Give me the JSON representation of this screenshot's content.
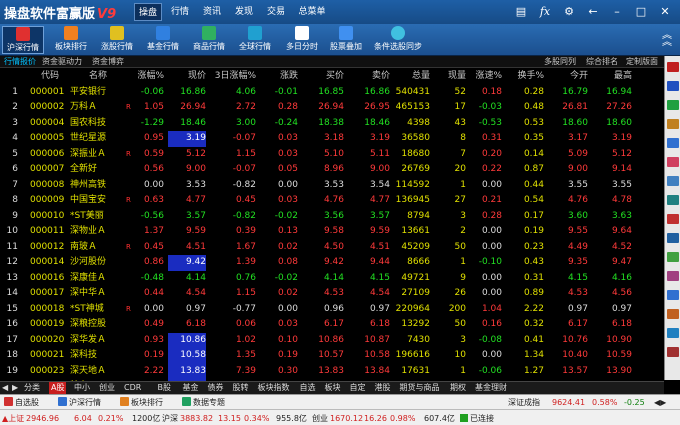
{
  "app": {
    "title": "操盘软件富赢版",
    "version": "V9"
  },
  "menu": [
    "操盘",
    "行情",
    "资讯",
    "发现",
    "交易",
    "总菜单"
  ],
  "toolbar": [
    {
      "label": "沪深行情",
      "color": "#e03030",
      "active": true
    },
    {
      "label": "板块排行",
      "color": "#f08020"
    },
    {
      "label": "涨股行情",
      "color": "#e0c020"
    },
    {
      "label": "基金行情",
      "color": "#3080e0"
    },
    {
      "label": "商品行情",
      "color": "#30b060"
    },
    {
      "label": "全球行情",
      "color": "#20a0d0"
    },
    {
      "label": "多日分时",
      "color": "#ffffff"
    },
    {
      "label": "股票叠加",
      "color": "#4090f0"
    },
    {
      "label": "条件选股同步",
      "color": "#40c0e0"
    }
  ],
  "subtabs": [
    "行情报价",
    "资金驱动力",
    "资金博弈"
  ],
  "subtabs_right": [
    "多股同列",
    "综合排名",
    "定制版面"
  ],
  "columns": [
    "代码",
    "名称",
    "涨幅%",
    "现价",
    "3日涨幅%",
    "涨跌",
    "买价",
    "卖价",
    "总量",
    "现量",
    "涨速%",
    "换手%",
    "今开",
    "最高"
  ],
  "rows": [
    {
      "i": "1",
      "code": "000001",
      "name": "平安银行",
      "flag": "",
      "pct": "-0.06",
      "price": "16.86",
      "d3": "4.06",
      "chg": "-0.01",
      "buy": "16.85",
      "sell": "16.86",
      "vol": "540431",
      "cur": "52",
      "spd": "0.18",
      "turn": "0.28",
      "open": "16.79",
      "high": "16.94",
      "dir": "dn"
    },
    {
      "i": "2",
      "code": "000002",
      "name": "万科Ａ",
      "flag": "R",
      "pct": "1.05",
      "price": "26.94",
      "d3": "2.72",
      "chg": "0.28",
      "buy": "26.94",
      "sell": "26.95",
      "vol": "465153",
      "cur": "17",
      "spd": "-0.03",
      "turn": "0.48",
      "open": "26.81",
      "high": "27.26",
      "dir": "up"
    },
    {
      "i": "3",
      "code": "000004",
      "name": "国农科技",
      "flag": "",
      "pct": "-1.29",
      "price": "18.46",
      "d3": "3.00",
      "chg": "-0.24",
      "buy": "18.38",
      "sell": "18.46",
      "vol": "4398",
      "cur": "43",
      "spd": "-0.53",
      "turn": "0.53",
      "open": "18.60",
      "high": "18.60",
      "dir": "dn"
    },
    {
      "i": "4",
      "code": "000005",
      "name": "世纪星源",
      "flag": "",
      "pct": "0.95",
      "price": "3.19",
      "d3": "-0.07",
      "chg": "0.03",
      "buy": "3.18",
      "sell": "3.19",
      "vol": "36580",
      "cur": "8",
      "spd": "0.31",
      "turn": "0.35",
      "open": "3.17",
      "high": "3.19",
      "dir": "up",
      "hl": true
    },
    {
      "i": "5",
      "code": "000006",
      "name": "深振业Ａ",
      "flag": "R",
      "pct": "0.59",
      "price": "5.12",
      "d3": "1.15",
      "chg": "0.03",
      "buy": "5.10",
      "sell": "5.11",
      "vol": "18680",
      "cur": "7",
      "spd": "0.20",
      "turn": "0.14",
      "open": "5.09",
      "high": "5.12",
      "dir": "up"
    },
    {
      "i": "6",
      "code": "000007",
      "name": "全新好",
      "flag": "",
      "pct": "0.56",
      "price": "9.00",
      "d3": "-0.07",
      "chg": "0.05",
      "buy": "8.96",
      "sell": "9.00",
      "vol": "26769",
      "cur": "20",
      "spd": "0.22",
      "turn": "0.87",
      "open": "9.00",
      "high": "9.14",
      "dir": "up"
    },
    {
      "i": "7",
      "code": "000008",
      "name": "神州高铁",
      "flag": "",
      "pct": "0.00",
      "price": "3.53",
      "d3": "-0.82",
      "chg": "0.00",
      "buy": "3.53",
      "sell": "3.54",
      "vol": "114592",
      "cur": "1",
      "spd": "0.00",
      "turn": "0.44",
      "open": "3.55",
      "high": "3.55",
      "dir": "eq"
    },
    {
      "i": "8",
      "code": "000009",
      "name": "中国宝安",
      "flag": "R",
      "pct": "0.63",
      "price": "4.77",
      "d3": "0.45",
      "chg": "0.03",
      "buy": "4.76",
      "sell": "4.77",
      "vol": "136945",
      "cur": "27",
      "spd": "0.21",
      "turn": "0.54",
      "open": "4.76",
      "high": "4.78",
      "dir": "up"
    },
    {
      "i": "9",
      "code": "000010",
      "name": "*ST美丽",
      "flag": "",
      "pct": "-0.56",
      "price": "3.57",
      "d3": "-0.82",
      "chg": "-0.02",
      "buy": "3.56",
      "sell": "3.57",
      "vol": "8794",
      "cur": "3",
      "spd": "0.28",
      "turn": "0.17",
      "open": "3.60",
      "high": "3.63",
      "dir": "dn"
    },
    {
      "i": "10",
      "code": "000011",
      "name": "深物业Ａ",
      "flag": "",
      "pct": "1.37",
      "price": "9.59",
      "d3": "0.39",
      "chg": "0.13",
      "buy": "9.58",
      "sell": "9.59",
      "vol": "13661",
      "cur": "2",
      "spd": "0.00",
      "turn": "0.19",
      "open": "9.55",
      "high": "9.64",
      "dir": "up"
    },
    {
      "i": "11",
      "code": "000012",
      "name": "南玻Ａ",
      "flag": "R",
      "pct": "0.45",
      "price": "4.51",
      "d3": "1.67",
      "chg": "0.02",
      "buy": "4.50",
      "sell": "4.51",
      "vol": "45209",
      "cur": "50",
      "spd": "0.00",
      "turn": "0.23",
      "open": "4.49",
      "high": "4.52",
      "dir": "up"
    },
    {
      "i": "12",
      "code": "000014",
      "name": "沙河股份",
      "flag": "",
      "pct": "0.86",
      "price": "9.42",
      "d3": "1.39",
      "chg": "0.08",
      "buy": "9.42",
      "sell": "9.44",
      "vol": "8666",
      "cur": "1",
      "spd": "-0.10",
      "turn": "0.43",
      "open": "9.35",
      "high": "9.47",
      "dir": "up",
      "hl": true
    },
    {
      "i": "13",
      "code": "000016",
      "name": "深康佳Ａ",
      "flag": "",
      "pct": "-0.48",
      "price": "4.14",
      "d3": "0.76",
      "chg": "-0.02",
      "buy": "4.14",
      "sell": "4.15",
      "vol": "49721",
      "cur": "9",
      "spd": "0.00",
      "turn": "0.31",
      "open": "4.15",
      "high": "4.16",
      "dir": "dn"
    },
    {
      "i": "14",
      "code": "000017",
      "name": "深中华Ａ",
      "flag": "",
      "pct": "0.44",
      "price": "4.54",
      "d3": "1.15",
      "chg": "0.02",
      "buy": "4.53",
      "sell": "4.54",
      "vol": "27109",
      "cur": "26",
      "spd": "0.00",
      "turn": "0.89",
      "open": "4.53",
      "high": "4.56",
      "dir": "up"
    },
    {
      "i": "15",
      "code": "000018",
      "name": "*ST神城",
      "flag": "R",
      "pct": "0.00",
      "price": "0.97",
      "d3": "-0.77",
      "chg": "0.00",
      "buy": "0.96",
      "sell": "0.97",
      "vol": "220964",
      "cur": "200",
      "spd": "1.04",
      "turn": "2.22",
      "open": "0.97",
      "high": "0.97",
      "dir": "eq"
    },
    {
      "i": "16",
      "code": "000019",
      "name": "深粮控股",
      "flag": "",
      "pct": "0.49",
      "price": "6.18",
      "d3": "0.06",
      "chg": "0.03",
      "buy": "6.17",
      "sell": "6.18",
      "vol": "13292",
      "cur": "50",
      "spd": "0.16",
      "turn": "0.32",
      "open": "6.17",
      "high": "6.18",
      "dir": "up"
    },
    {
      "i": "17",
      "code": "000020",
      "name": "深华发Ａ",
      "flag": "",
      "pct": "0.93",
      "price": "10.86",
      "d3": "1.02",
      "chg": "0.10",
      "buy": "10.86",
      "sell": "10.87",
      "vol": "7430",
      "cur": "3",
      "spd": "-0.08",
      "turn": "0.41",
      "open": "10.76",
      "high": "10.90",
      "dir": "up",
      "hl": true
    },
    {
      "i": "18",
      "code": "000021",
      "name": "深科技",
      "flag": "",
      "pct": "0.19",
      "price": "10.58",
      "d3": "1.35",
      "chg": "0.19",
      "buy": "10.57",
      "sell": "10.58",
      "vol": "196616",
      "cur": "10",
      "spd": "0.00",
      "turn": "1.34",
      "open": "10.40",
      "high": "10.59",
      "dir": "up",
      "hl": true
    },
    {
      "i": "19",
      "code": "000023",
      "name": "深天地Ａ",
      "flag": "",
      "pct": "2.22",
      "price": "13.83",
      "d3": "7.39",
      "chg": "0.30",
      "buy": "13.83",
      "sell": "13.84",
      "vol": "17631",
      "cur": "1",
      "spd": "-0.06",
      "turn": "1.27",
      "open": "13.57",
      "high": "13.90",
      "dir": "up",
      "hl": true
    },
    {
      "i": "20",
      "code": "000025",
      "name": "特力Ａ",
      "flag": "",
      "pct": "-0.23",
      "price": "21.37",
      "d3": "-0.79",
      "chg": "-0.05",
      "buy": "21.37",
      "sell": "21.39",
      "vol": "22983",
      "cur": "7",
      "spd": "0.09",
      "turn": "0.59",
      "open": "21.32",
      "high": "21.39",
      "dir": "dn",
      "hl": true
    }
  ],
  "bottom_tabs": [
    "分类",
    "A股",
    "中小",
    "创业",
    "CDR",
    "B股",
    "基金",
    "债券",
    "股转",
    "板块指数",
    "自选",
    "板块",
    "自定",
    "港股",
    "期货与商品",
    "期权",
    "基金理财"
  ],
  "bottom_tab_active": "A股",
  "newsbar": {
    "items": [
      "自选股",
      "沪深行情",
      "板块排行",
      "数据专题"
    ],
    "market": "深证成指",
    "market_value": "9624.41",
    "market_pct": "0.58%",
    "market_vol": "-0.25"
  },
  "status": {
    "sh_label": "上证",
    "sh_value": "2946.96",
    "sh_chg": "6.04",
    "sh_pct": "0.21%",
    "sh_amt": "1200亿",
    "hs_label": "沪深",
    "hs_value": "3883.82",
    "hs_chg": "13.15",
    "hs_pct": "0.34%",
    "hs_amt": "955.8亿",
    "cy_label": "创业",
    "cy_value": "1670.12",
    "cy_chg": "16.26",
    "cy_pct": "0.98%",
    "cy_amt": "607.4亿",
    "conn": "已连接"
  }
}
